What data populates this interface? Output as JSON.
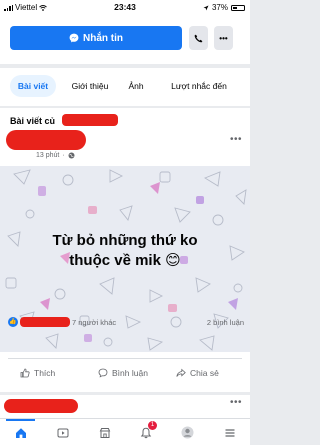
{
  "status_bar": {
    "carrier": "Viettel",
    "time": "23:43",
    "battery": "37%"
  },
  "header": {
    "message_label": "Nhắn tin"
  },
  "tabs": [
    {
      "label": "Bài viết",
      "active": true
    },
    {
      "label": "Giới thiệu",
      "active": false
    },
    {
      "label": "Ảnh",
      "active": false
    },
    {
      "label": "Lượt nhắc đến",
      "active": false
    }
  ],
  "post": {
    "section_title": "Bài viết củ",
    "time": "13 phút",
    "more_label": "•••",
    "image_text_line1": "Từ bỏ những thứ ko",
    "image_text_line2": "thuộc về mik 😊",
    "reactions_others": "7 người khác",
    "comments_count": "2 bình luận",
    "actions": {
      "like": "Thích",
      "comment": "Bình luận",
      "share": "Chia sẻ"
    }
  },
  "bottom_nav": [
    {
      "icon": "home-icon",
      "active": true
    },
    {
      "icon": "video-icon",
      "active": false
    },
    {
      "icon": "marketplace-icon",
      "active": false
    },
    {
      "icon": "bell-icon",
      "active": false,
      "badge": "1"
    },
    {
      "icon": "avatar-icon",
      "active": false
    },
    {
      "icon": "menu-icon",
      "active": false
    }
  ],
  "colors": {
    "accent": "#1877f2",
    "redaction": "#e8221b",
    "badge": "#e41e3f"
  }
}
